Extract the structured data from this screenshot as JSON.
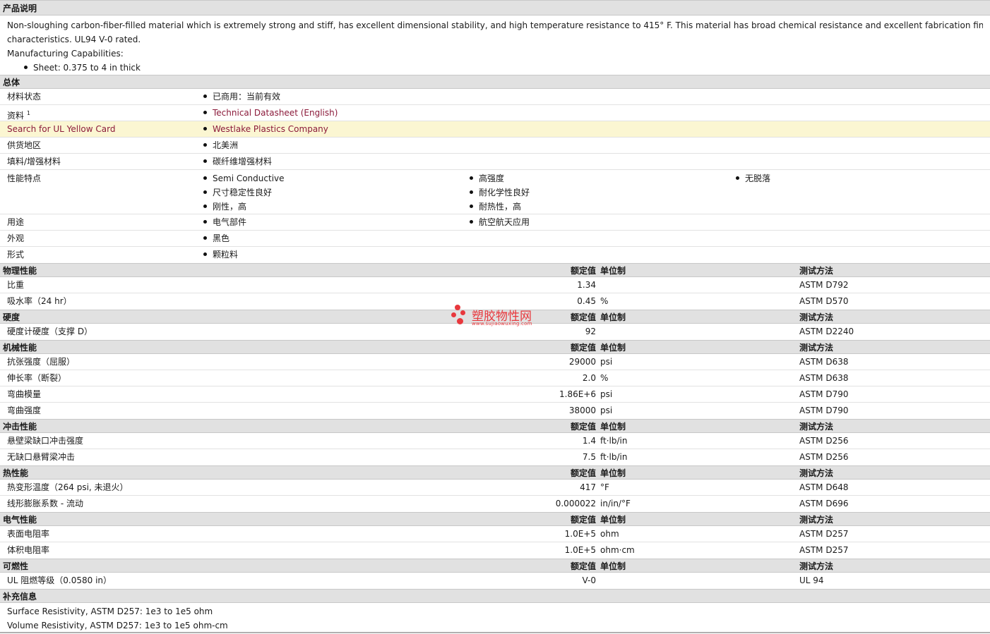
{
  "desc": {
    "title": "产品说明",
    "para": "Non-sloughing carbon-fiber-filled material which is extremely strong and stiff, has excellent dimensional stability, and high temperature resistance to 415° F. This material has broad chemical resistance and excellent fabrication finishing",
    "para2": "characteristics. UL94 V-0 rated.",
    "cap_label": "Manufacturing Capabilities:",
    "cap_item": "Sheet: 0.375 to 4 in thick"
  },
  "general": {
    "title": "总体",
    "status_label": "材料状态",
    "status_value": "已商用：当前有效",
    "info_label": "资料",
    "info_sup": "1",
    "info_value": "Technical Datasheet (English)",
    "ul_label": "Search for UL Yellow Card",
    "ul_value": "Westlake Plastics Company",
    "region_label": "供货地区",
    "region_value": "北美洲",
    "filler_label": "填料/增强材料",
    "filler_value": "碳纤维增强材料",
    "features_label": "性能特点",
    "features": [
      "Semi Conductive",
      "高强度",
      "无脱落",
      "尺寸稳定性良好",
      "耐化学性良好",
      "刚性，高",
      "耐热性，高"
    ],
    "uses_label": "用途",
    "uses": [
      "电气部件",
      "航空航天应用"
    ],
    "appearance_label": "外观",
    "appearance_value": "黑色",
    "form_label": "形式",
    "form_value": "颗粒料"
  },
  "headers": {
    "value": "额定值",
    "unit": "单位制",
    "test": "测试方法"
  },
  "physical": {
    "title": "物理性能",
    "rows": [
      {
        "label": "比重",
        "value": "1.34",
        "unit": "",
        "test": "ASTM D792"
      },
      {
        "label": "吸水率（24 hr）",
        "value": "0.45",
        "unit": "%",
        "test": "ASTM D570"
      }
    ]
  },
  "hardness": {
    "title": "硬度",
    "rows": [
      {
        "label": "硬度计硬度（支撑 D）",
        "value": "92",
        "unit": "",
        "test": "ASTM D2240"
      }
    ]
  },
  "mechanical": {
    "title": "机械性能",
    "rows": [
      {
        "label": "抗张强度（屈服）",
        "value": "29000",
        "unit": "psi",
        "test": "ASTM D638"
      },
      {
        "label": "伸长率（断裂）",
        "value": "2.0",
        "unit": "%",
        "test": "ASTM D638"
      },
      {
        "label": "弯曲模量",
        "value": "1.86E+6",
        "unit": "psi",
        "test": "ASTM D790"
      },
      {
        "label": "弯曲强度",
        "value": "38000",
        "unit": "psi",
        "test": "ASTM D790"
      }
    ]
  },
  "impact": {
    "title": "冲击性能",
    "rows": [
      {
        "label": "悬壁梁缺口冲击强度",
        "value": "1.4",
        "unit": "ft·lb/in",
        "test": "ASTM D256"
      },
      {
        "label": "无缺口悬臂梁冲击",
        "value": "7.5",
        "unit": "ft·lb/in",
        "test": "ASTM D256"
      }
    ]
  },
  "thermal": {
    "title": "热性能",
    "rows": [
      {
        "label": "热变形温度（264 psi, 未退火）",
        "value": "417",
        "unit": "°F",
        "test": "ASTM D648"
      },
      {
        "label": "线形膨胀系数 - 流动",
        "value": "0.000022",
        "unit": "in/in/°F",
        "test": "ASTM D696"
      }
    ]
  },
  "electrical": {
    "title": "电气性能",
    "rows": [
      {
        "label": "表面电阻率",
        "value": "1.0E+5",
        "unit": "ohm",
        "test": "ASTM D257"
      },
      {
        "label": "体积电阻率",
        "value": "1.0E+5",
        "unit": "ohm·cm",
        "test": "ASTM D257"
      }
    ]
  },
  "flammability": {
    "title": "可燃性",
    "rows": [
      {
        "label": "UL 阻燃等级（0.0580 in）",
        "value": "V-0",
        "unit": "",
        "test": "UL 94"
      }
    ]
  },
  "supplement": {
    "title": "补充信息",
    "lines": [
      "Surface Resistivity, ASTM D257: 1e3 to 1e5 ohm",
      "Volume Resistivity, ASTM D257: 1e3 to 1e5 ohm-cm"
    ]
  },
  "watermark": {
    "text": "塑胶物性网",
    "sub": "www.sujiaowuxing.com",
    "color": "#e8383d"
  }
}
